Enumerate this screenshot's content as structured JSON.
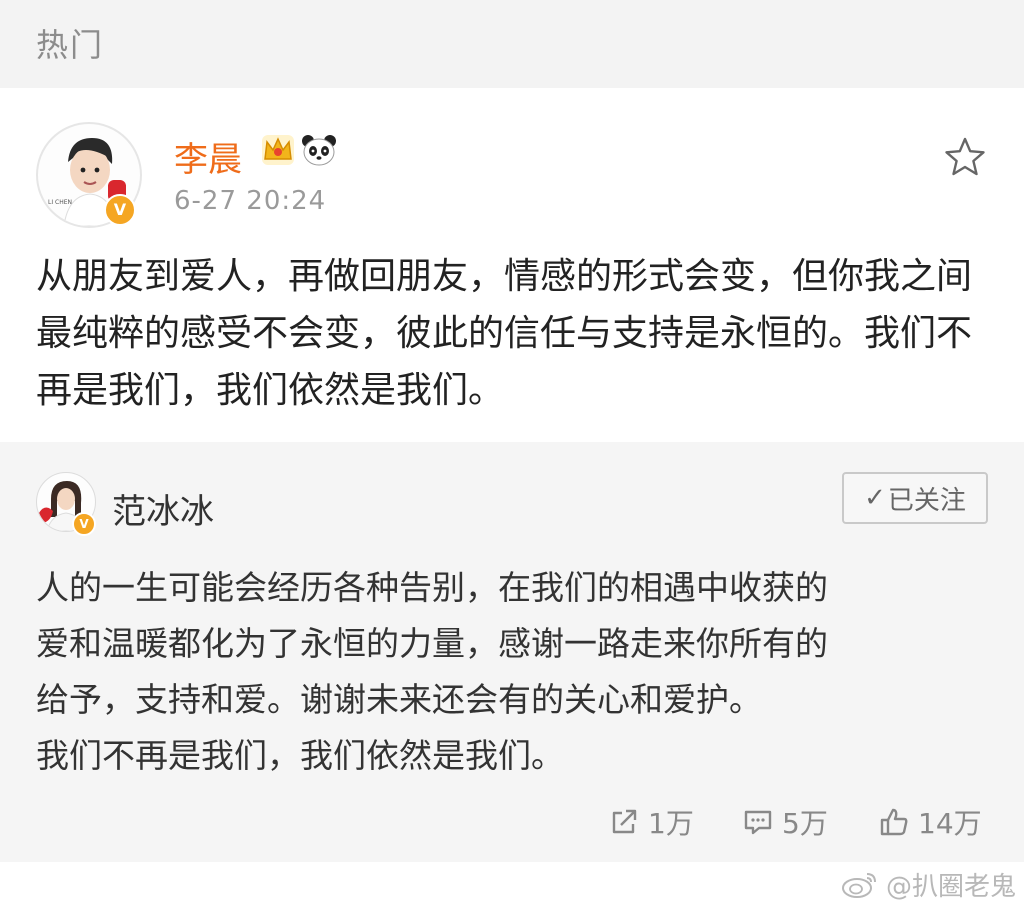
{
  "header": {
    "title": "热门"
  },
  "post": {
    "author": "李晨",
    "author_color": "#ef6c1a",
    "badges": [
      "crown-icon",
      "panda-icon"
    ],
    "avatar_caption": "LI CHEN",
    "timestamp": "6-27 20:24",
    "text": "从朋友到爱人，再做回朋友，情感的形式会变，但你我之间最纯粹的感受不会变，彼此的信任与支持是永恒的。我们不再是我们，我们依然是我们。"
  },
  "repost": {
    "author": "范冰冰",
    "follow_label": "已关注",
    "text_lines": [
      "人的一生可能会经历各种告别，在我们的相遇中收获的",
      "爱和温暖都化为了永恒的力量，感谢一路走来你所有的",
      "给予，支持和爱。谢谢未来还会有的关心和爱护。",
      "我们不再是我们，我们依然是我们。"
    ],
    "stats": {
      "share_count": "1万",
      "comment_count": "5万",
      "like_count": "14万"
    }
  },
  "watermark": "@扒圈老鬼",
  "verified_badge": "V",
  "colors": {
    "accent_orange": "#ef6c1a",
    "verified_gold": "#f5a623",
    "repost_bg": "#f5f5f5"
  }
}
